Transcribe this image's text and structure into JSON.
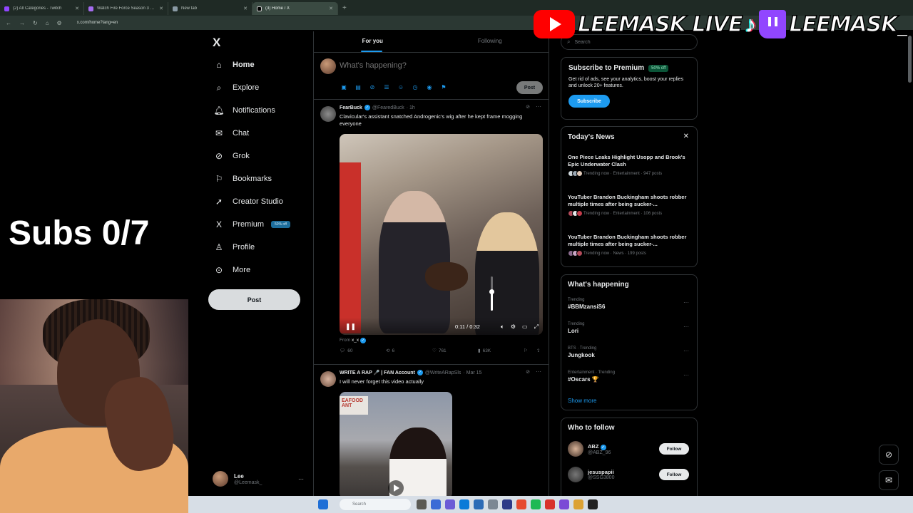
{
  "browser": {
    "tabs": [
      {
        "title": "(2) All Categories - Twitch",
        "color": "#9146ff",
        "active": false
      },
      {
        "title": "Watch Fire Force Season 3 onl",
        "color": "#a56cf0",
        "active": false
      },
      {
        "title": "New tab",
        "color": "#8a9aa5",
        "active": false
      },
      {
        "title": "(3) Home / X",
        "color": "#e7e9ea",
        "active": true
      }
    ],
    "new_tab": "+",
    "url": "x.com/home?lang=en"
  },
  "overlay": {
    "banner_youtube": "LEEMASK LIVE",
    "banner_twitch": "LEEMASK_",
    "subs_label": "Subs 0/7"
  },
  "nav": {
    "logo": "X",
    "items": [
      {
        "label": "Home",
        "icon": "home-icon",
        "glyph": "⌂"
      },
      {
        "label": "Explore",
        "icon": "search-icon",
        "glyph": "⌕"
      },
      {
        "label": "Notifications",
        "icon": "bell-icon",
        "glyph": "♫"
      },
      {
        "label": "Chat",
        "icon": "mail-icon",
        "glyph": "✉"
      },
      {
        "label": "Grok",
        "icon": "grok-icon",
        "glyph": "⊘"
      },
      {
        "label": "Bookmarks",
        "icon": "bookmark-icon",
        "glyph": "⚑"
      },
      {
        "label": "Creator Studio",
        "icon": "rocket-icon",
        "glyph": "➚"
      },
      {
        "label": "Premium",
        "icon": "x-icon",
        "glyph": "X",
        "badge": "50% off"
      },
      {
        "label": "Profile",
        "icon": "person-icon",
        "glyph": "♙"
      },
      {
        "label": "More",
        "icon": "more-circle-icon",
        "glyph": "⊙"
      }
    ],
    "post_button": "Post",
    "account": {
      "name": "Lee",
      "handle": "@Leemask_",
      "more": "···"
    }
  },
  "feed": {
    "tabs": [
      "For you",
      "Following"
    ],
    "composer_placeholder": "What's happening?",
    "composer_post": "Post",
    "tweets": [
      {
        "name": "FearBuck",
        "handle": "@FearedBuck",
        "time": "· 1h",
        "text": "Clavicular's assistant snatched Androgenic's wig after he kept frame mogging everyone",
        "video_time": "0:11 / 0:32",
        "volume_level": 0.55,
        "from_label": "From",
        "from_user": "x_x",
        "replies": "60",
        "reposts": "6",
        "likes": "761",
        "views": "63K"
      },
      {
        "name": "WRITE A RAP 🎤 | FAN Account",
        "handle": "@WriteARapSls",
        "time": "· Mar 15",
        "text": "I will never forget this video actually",
        "sign_text": "EAFOOD ANT"
      }
    ]
  },
  "sidebar": {
    "search_placeholder": "Search",
    "premium": {
      "title": "Subscribe to Premium",
      "badge": "50% off",
      "description": "Get rid of ads, see your analytics, boost your replies and unlock 20+ features.",
      "button": "Subscribe"
    },
    "news": {
      "title": "Today's News",
      "items": [
        {
          "headline": "One Piece Leaks Highlight Usopp and Brook's Epic Underwater Clash",
          "meta": "Trending now · Entertainment · 947 posts"
        },
        {
          "headline": "YouTuber Brandon Buckingham shoots robber multiple times after being sucker-...",
          "meta": "Trending now · Entertainment · 106 posts"
        },
        {
          "headline": "YouTuber Brandon Buckingham shoots robber multiple times after being sucker-...",
          "meta": "Trending now · News · 199 posts"
        }
      ]
    },
    "happening": {
      "title": "What's happening",
      "trends": [
        {
          "context": "Trending",
          "name": "#BBMzansiS6"
        },
        {
          "context": "Trending",
          "name": "Lori"
        },
        {
          "context": "BTS · Trending",
          "name": "Jungkook"
        },
        {
          "context": "Entertainment · Trending",
          "name": "#Oscars 🏆"
        }
      ],
      "show_more": "Show more"
    },
    "follow": {
      "title": "Who to follow",
      "users": [
        {
          "name": "ABZ",
          "handle": "@ABZ_96",
          "button": "Follow"
        },
        {
          "name": "jesuspapii",
          "handle": "@SSG3800",
          "button": "Follow"
        }
      ]
    }
  },
  "taskbar": {
    "search": "Search"
  }
}
